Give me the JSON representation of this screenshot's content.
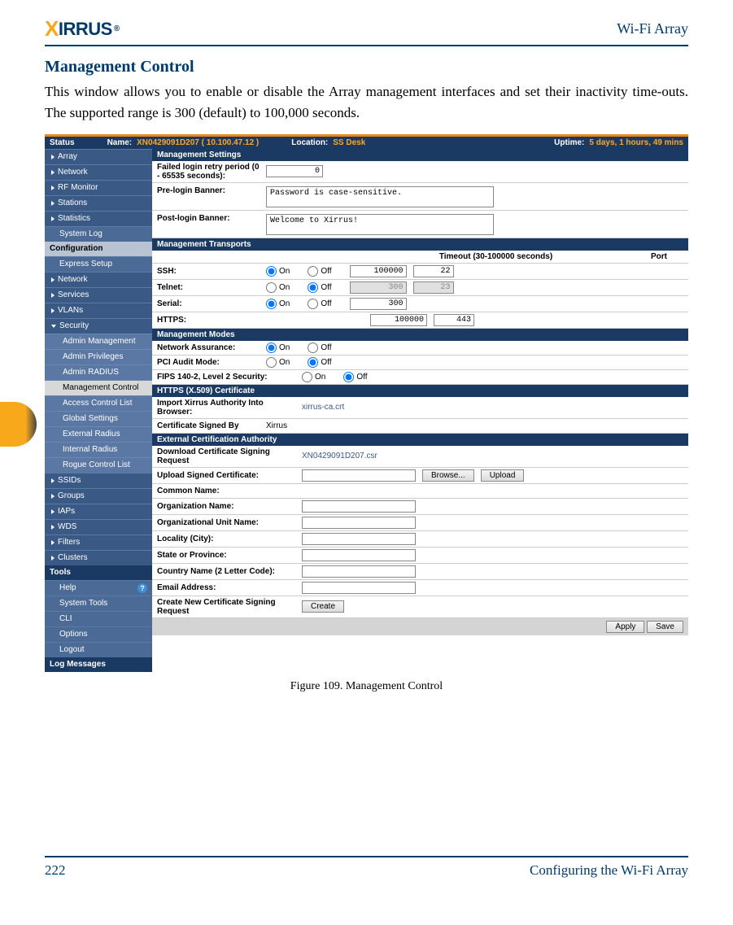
{
  "header": {
    "brand": "XIRRUS",
    "right": "Wi-Fi Array"
  },
  "section": {
    "title": "Management Control"
  },
  "body": {
    "para": "This window allows you to enable or disable the Array management interfaces and set their inactivity time-outs. The supported range is 300 (default) to 100,000 seconds."
  },
  "caption": "Figure 109. Management Control",
  "footer": {
    "page": "222",
    "chapter": "Configuring the Wi-Fi Array"
  },
  "ui": {
    "status": {
      "label": "Status",
      "name_label": "Name:",
      "name": "XN0429091D207   ( 10.100.47.12 )",
      "loc_label": "Location:",
      "loc": "SS Desk",
      "up_label": "Uptime:",
      "up": "5 days, 1 hours, 49 mins"
    },
    "sidebar": {
      "status_items": [
        "Array",
        "Network",
        "RF Monitor",
        "Stations",
        "Statistics",
        "System Log"
      ],
      "config_head": "Configuration",
      "config_items": [
        "Express Setup",
        "Network",
        "Services",
        "VLANs",
        "Security"
      ],
      "security_sub": [
        "Admin Management",
        "Admin Privileges",
        "Admin RADIUS",
        "Management Control",
        "Access Control List",
        "Global Settings",
        "External Radius",
        "Internal Radius",
        "Rogue Control List"
      ],
      "config_rest": [
        "SSIDs",
        "Groups",
        "IAPs",
        "WDS",
        "Filters",
        "Clusters"
      ],
      "tools_head": "Tools",
      "tools_items": [
        "Help",
        "System Tools",
        "CLI",
        "Options",
        "Logout"
      ],
      "log_head": "Log Messages"
    },
    "panels": {
      "mgmt_settings": "Management Settings",
      "retry_label": "Failed login retry period (0 - 65535 seconds):",
      "retry_val": "0",
      "pre_banner_label": "Pre-login Banner:",
      "pre_banner_val": "Password is case-sensitive.",
      "post_banner_label": "Post-login Banner:",
      "post_banner_val": "Welcome to Xirrus!",
      "transports": "Management Transports",
      "th_timeout": "Timeout (30-100000 seconds)",
      "th_port": "Port",
      "on": "On",
      "off": "Off",
      "ssh": "SSH:",
      "ssh_to": "100000",
      "ssh_port": "22",
      "telnet": "Telnet:",
      "telnet_to": "300",
      "telnet_port": "23",
      "serial": "Serial:",
      "serial_to": "300",
      "https": "HTTPS:",
      "https_to": "100000",
      "https_port": "443",
      "modes": "Management Modes",
      "net_assure": "Network Assurance:",
      "pci": "PCI Audit Mode:",
      "fips": "FIPS 140-2, Level 2 Security:",
      "cert": "HTTPS (X.509) Certificate",
      "import_label": "Import Xirrus Authority Into Browser:",
      "import_val": "xirrus-ca.crt",
      "signed_label": "Certificate Signed By",
      "signed_val": "Xirrus",
      "ext_auth": "External Certification Authority",
      "dl_csr_label": "Download Certificate Signing Request",
      "dl_csr_val": "XN0429091D207.csr",
      "upload_label": "Upload Signed Certificate:",
      "browse": "Browse...",
      "upload": "Upload",
      "cn": "Common Name:",
      "org": "Organization Name:",
      "ou": "Organizational Unit Name:",
      "city": "Locality (City):",
      "state": "State or Province:",
      "country": "Country Name (2 Letter Code):",
      "email": "Email Address:",
      "create_csr": "Create New Certificate Signing Request",
      "create": "Create",
      "apply": "Apply",
      "save": "Save"
    }
  }
}
